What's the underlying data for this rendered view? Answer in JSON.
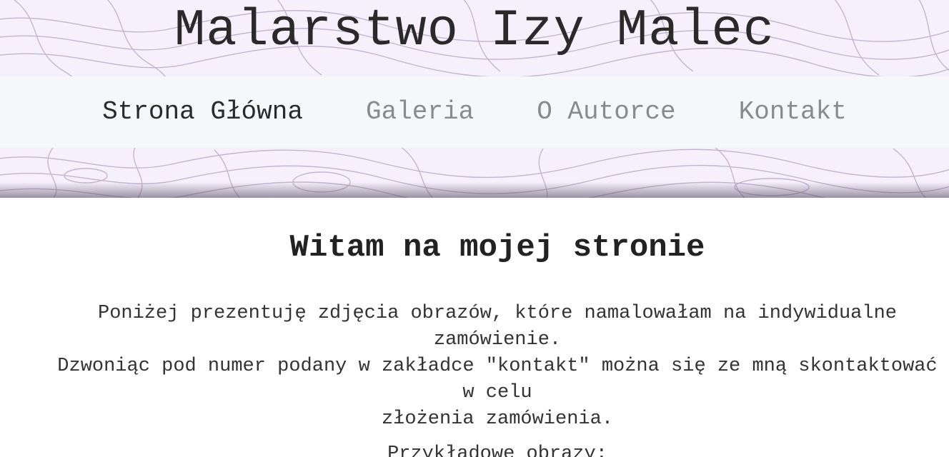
{
  "header": {
    "site_title": "Malarstwo Izy Malec"
  },
  "nav": {
    "items": [
      {
        "label": "Strona Główna",
        "active": true
      },
      {
        "label": "Galeria",
        "active": false
      },
      {
        "label": "O Autorce",
        "active": false
      },
      {
        "label": "Kontakt",
        "active": false
      }
    ]
  },
  "main": {
    "heading": "Witam na mojej stronie",
    "intro_lines": [
      "Poniżej prezentuję zdjęcia obrazów, które namalowałam na indywidualne zamówienie.",
      "Dzwoniąc pod numer podany w zakładce \"kontakt\" można się ze mną skontaktować w celu",
      "złożenia zamówienia."
    ],
    "examples_label": "Przykładowe obrazy:"
  },
  "colors": {
    "header_bg": "#f5f0fc",
    "topo_line": "#b9adc9",
    "nav_bg": "#f6f7f9",
    "nav_active": "#2a2a2a",
    "nav_inactive": "#8a8a8a"
  }
}
